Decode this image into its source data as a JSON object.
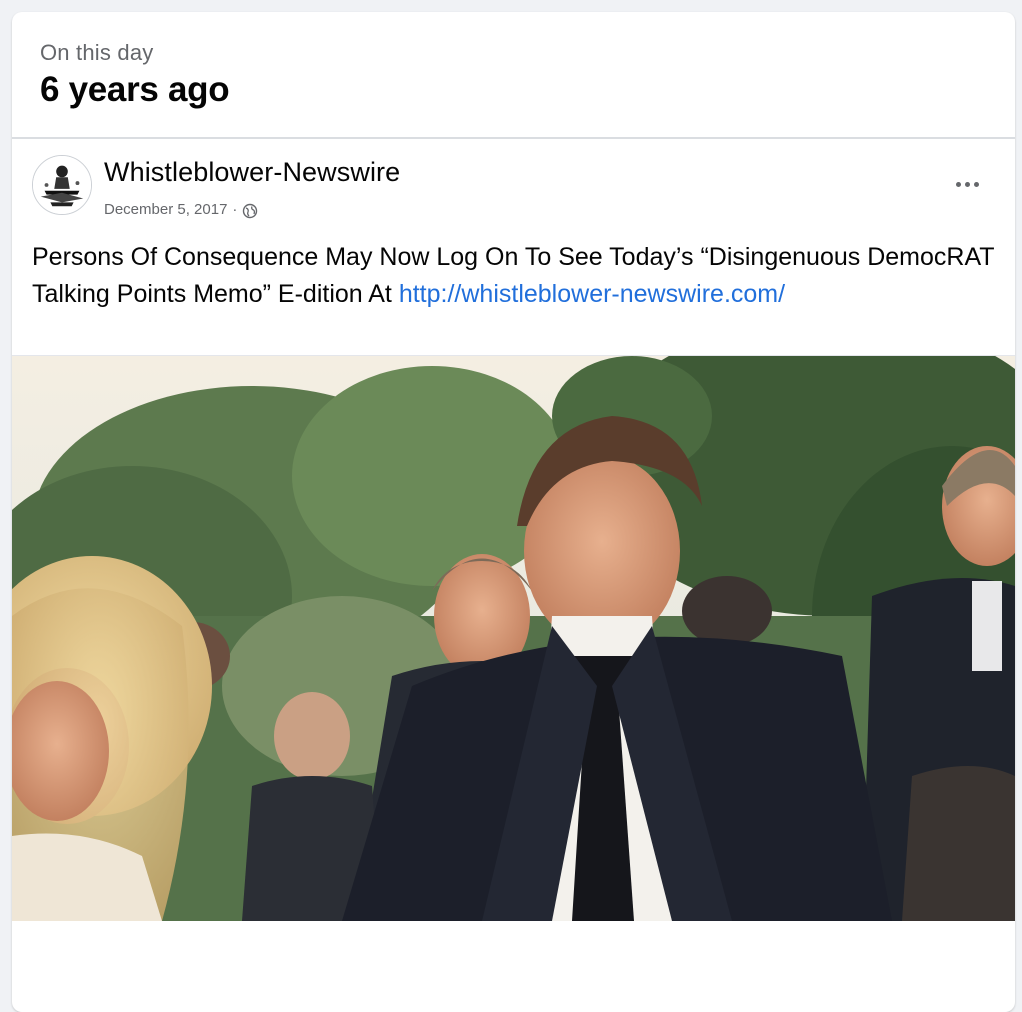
{
  "memory": {
    "label": "On this day",
    "title": "6 years ago"
  },
  "post": {
    "page_name": "Whistleblower-Newswire",
    "date": "December 5, 2017",
    "separator": "·",
    "audience_icon": "globe-icon",
    "more_icon": "more-options-icon",
    "text": "Persons Of Consequence May Now Log On To See Today’s “Disingenuous DemocRAT Talking Points Memo” E-dition At ",
    "link": "http://whistleblower-newswire.com/",
    "image_icon": "photo-of-people-outdoors"
  },
  "colors": {
    "background": "#f0f2f5",
    "card": "#ffffff",
    "link": "#216fdb",
    "secondary_text": "#65676b"
  }
}
